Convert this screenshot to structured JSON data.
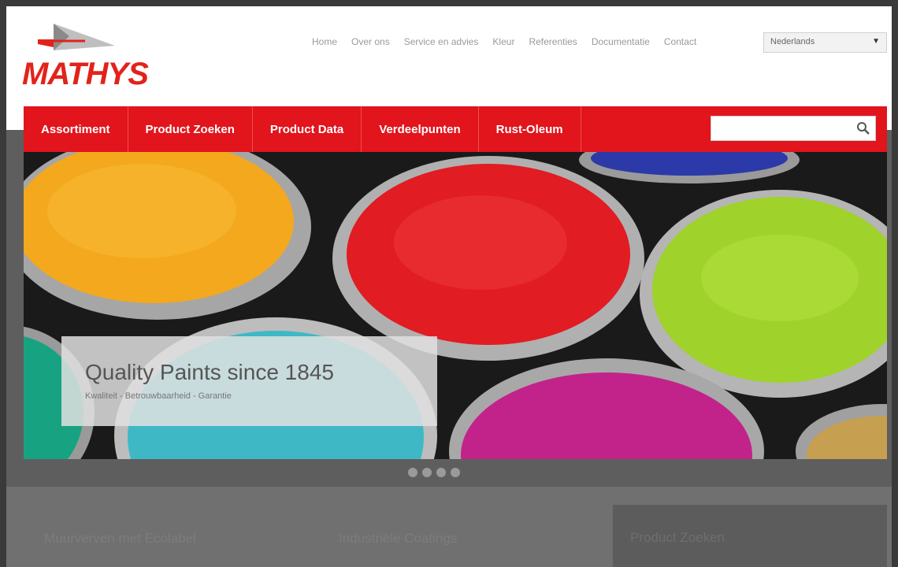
{
  "brand": {
    "name": "MATHYS",
    "color": "#e2231a"
  },
  "topnav": [
    "Home",
    "Over ons",
    "Service en advies",
    "Kleur",
    "Referenties",
    "Documentatie",
    "Contact"
  ],
  "language": {
    "selected": "Nederlands"
  },
  "mainnav": [
    "Assortiment",
    "Product Zoeken",
    "Product Data",
    "Verdeelpunten",
    "Rust-Oleum"
  ],
  "search": {
    "placeholder": "",
    "icon": "search-icon"
  },
  "hero": {
    "title": "Quality Paints since 1845",
    "subtitle": "Kwaliteit - Betrouwbaarheid - Garantie",
    "slides": 4,
    "active_slide": 1
  },
  "lower": {
    "col1": "Muurverven met Ecolabel",
    "col2": "Industriële Coatings",
    "side": "Product Zoeken"
  }
}
